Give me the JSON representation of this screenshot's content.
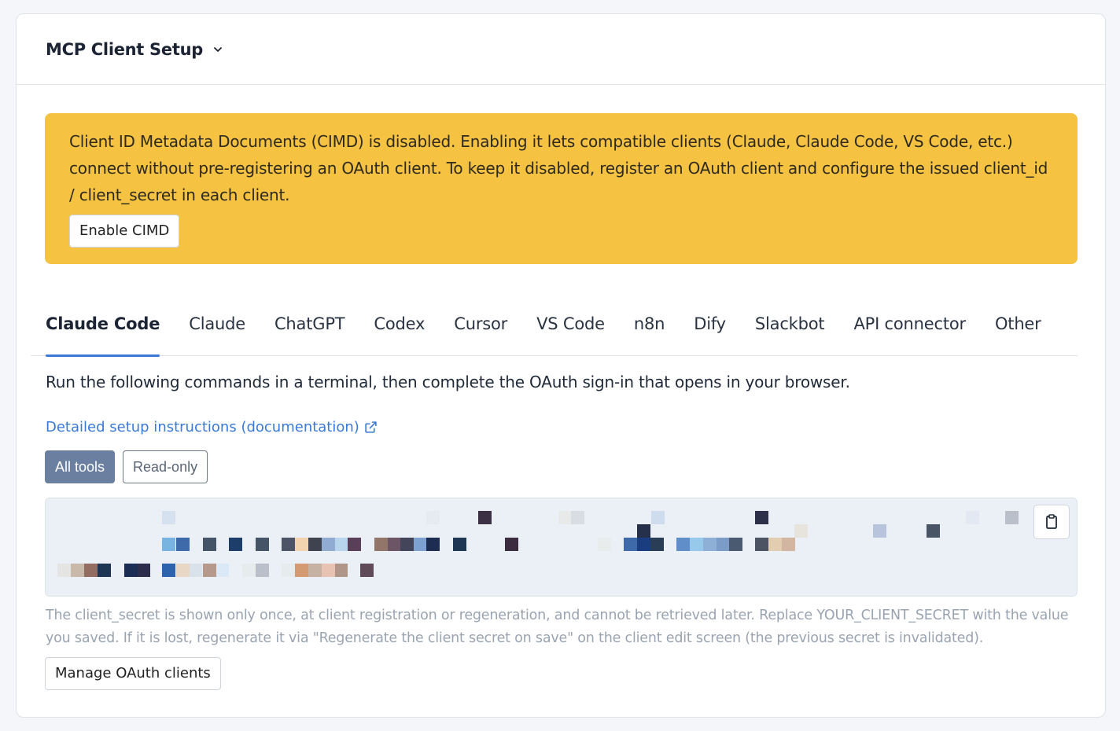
{
  "header": {
    "title": "MCP Client Setup"
  },
  "warning": {
    "message": "Client ID Metadata Documents (CIMD) is disabled. Enabling it lets compatible clients (Claude, Claude Code, VS Code, etc.) connect without pre-registering an OAuth client. To keep it disabled, register an OAuth client and configure the issued client_id / client_secret in each client.",
    "button_label": "Enable CIMD",
    "background_color": "#f5c242"
  },
  "tabs": [
    {
      "label": "Claude Code",
      "active": true
    },
    {
      "label": "Claude",
      "active": false
    },
    {
      "label": "ChatGPT",
      "active": false
    },
    {
      "label": "Codex",
      "active": false
    },
    {
      "label": "Cursor",
      "active": false
    },
    {
      "label": "VS Code",
      "active": false
    },
    {
      "label": "n8n",
      "active": false
    },
    {
      "label": "Dify",
      "active": false
    },
    {
      "label": "Slackbot",
      "active": false
    },
    {
      "label": "API connector",
      "active": false
    },
    {
      "label": "Other",
      "active": false
    }
  ],
  "main": {
    "instructions": "Run the following commands in a terminal, then complete the OAuth sign-in that opens in your browser.",
    "doc_link_label": "Detailed setup instructions (documentation)",
    "scope_options": [
      {
        "label": "All tools",
        "selected": true
      },
      {
        "label": "Read-only",
        "selected": false
      }
    ],
    "code_block": {
      "content_state": "pixelated / redacted",
      "copy_icon": "clipboard-icon"
    },
    "note": "The client_secret is shown only once, at client registration or regeneration, and cannot be retrieved later. Replace YOUR_CLIENT_SECRET with the value you saved. If it is lost, regenerate it via \"Regenerate the client secret on save\" on the client edit screen (the previous secret is invalidated).",
    "manage_button_label": "Manage OAuth clients"
  },
  "colors": {
    "accent": "#3a79d6",
    "toggle_active": "#6b80a0",
    "code_background": "#ebf0f7"
  }
}
